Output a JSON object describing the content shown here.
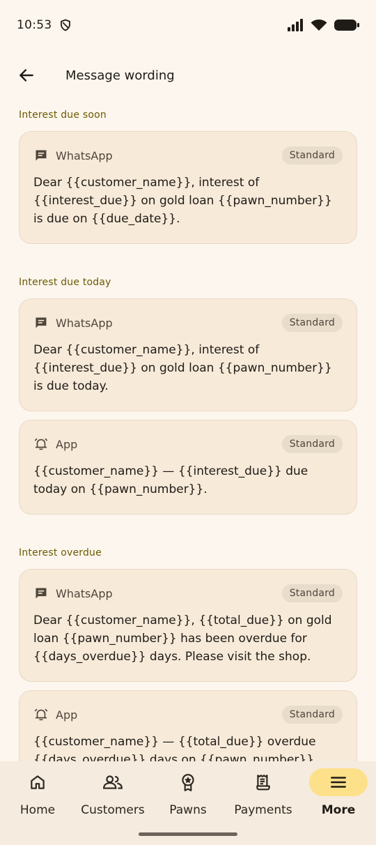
{
  "status": {
    "time": "10:53"
  },
  "header": {
    "title": "Message wording"
  },
  "sections": [
    {
      "title": "Interest due soon",
      "cards": [
        {
          "channel": "WhatsApp",
          "badge": "Standard",
          "text": "Dear {{customer_name}}, interest of {{interest_due}} on gold loan {{pawn_number}} is due on {{due_date}}."
        }
      ]
    },
    {
      "title": "Interest due today",
      "cards": [
        {
          "channel": "WhatsApp",
          "badge": "Standard",
          "text": "Dear {{customer_name}}, interest of {{interest_due}} on gold loan {{pawn_number}} is due today."
        },
        {
          "channel": "App",
          "badge": "Standard",
          "text": "{{customer_name}} — {{interest_due}} due today on {{pawn_number}}."
        }
      ]
    },
    {
      "title": "Interest overdue",
      "cards": [
        {
          "channel": "WhatsApp",
          "badge": "Standard",
          "text": "Dear {{customer_name}}, {{total_due}} on gold loan {{pawn_number}} has been overdue for {{days_overdue}} days. Please visit the shop."
        },
        {
          "channel": "App",
          "badge": "Standard",
          "text": "{{customer_name}} — {{total_due}} overdue {{days_overdue}} days on {{pawn_number}}."
        }
      ]
    }
  ],
  "nav": {
    "items": [
      {
        "label": "Home",
        "icon": "home-icon"
      },
      {
        "label": "Customers",
        "icon": "people-icon"
      },
      {
        "label": "Pawns",
        "icon": "medal-icon"
      },
      {
        "label": "Payments",
        "icon": "receipt-icon"
      },
      {
        "label": "More",
        "icon": "menu-icon",
        "active": true
      }
    ]
  },
  "colors": {
    "accent": "#fde08a",
    "background": "#fdf6ee",
    "card": "#f7ead9",
    "section_heading": "#6b5a00"
  }
}
